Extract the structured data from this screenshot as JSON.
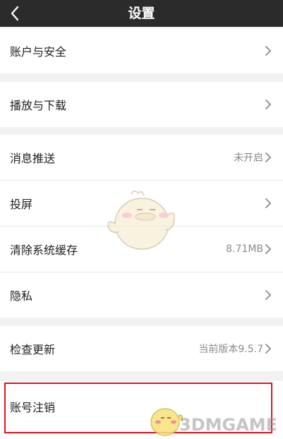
{
  "header": {
    "title": "设置",
    "back_icon": "chevron-left-icon"
  },
  "settings": {
    "account_security": {
      "label": "账户与安全"
    },
    "playback_download": {
      "label": "播放与下载"
    },
    "push": {
      "label": "消息推送",
      "value": "未开启"
    },
    "cast": {
      "label": "投屏"
    },
    "clear_cache": {
      "label": "清除系统缓存",
      "value": "8.71MB"
    },
    "privacy": {
      "label": "隐私"
    },
    "check_update": {
      "label": "检查更新",
      "value": "当前版本9.5.7"
    },
    "cancel_account": {
      "label": "账号注销"
    }
  },
  "watermark": {
    "text": "3DMGAME"
  },
  "colors": {
    "header_bg": "#2b2b2b",
    "highlight": "#e0141e",
    "page_bg": "#f2f2f2"
  }
}
